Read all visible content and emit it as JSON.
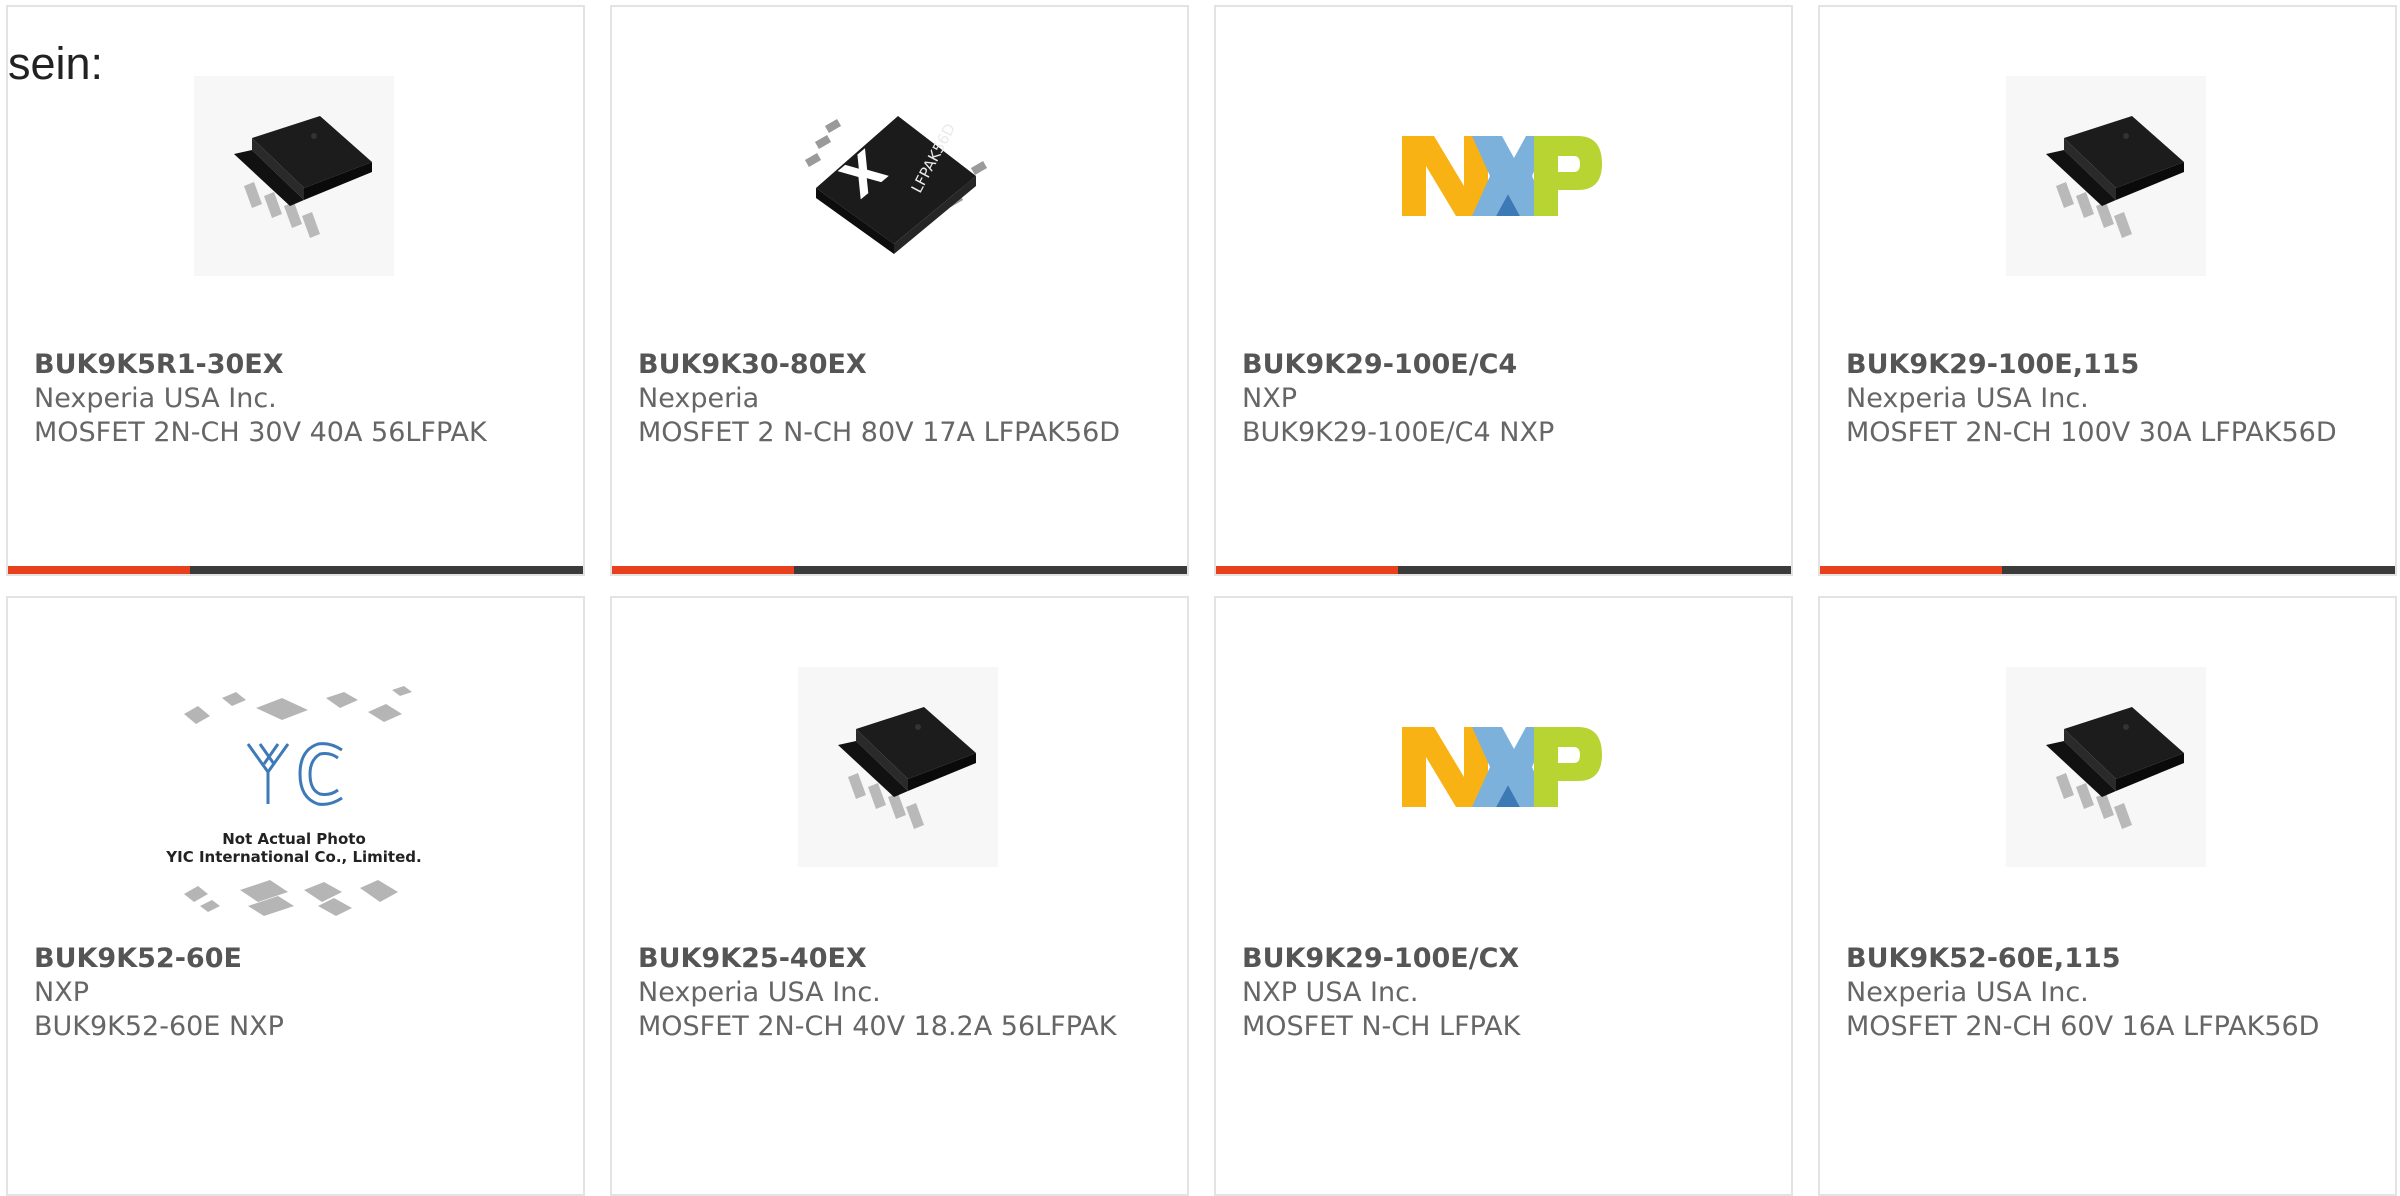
{
  "lead_text": "sein:",
  "products": [
    {
      "part": "BUK9K5R1-30EX",
      "manufacturer": "Nexperia USA Inc.",
      "description": "MOSFET 2N-CH 30V 40A 56LFPAK",
      "image": "lfpak-chip-photo"
    },
    {
      "part": "BUK9K30-80EX",
      "manufacturer": "Nexperia",
      "description": "MOSFET 2 N-CH 80V 17A LFPAK56D",
      "image": "lfpak56d-package",
      "image_text": "LFPAK56D"
    },
    {
      "part": "BUK9K29-100E/C4",
      "manufacturer": "NXP",
      "description": "BUK9K29-100E/C4 NXP",
      "image": "nxp-logo",
      "image_text": "NXP"
    },
    {
      "part": "BUK9K29-100E,115",
      "manufacturer": "Nexperia USA Inc.",
      "description": "MOSFET 2N-CH 100V 30A LFPAK56D",
      "image": "lfpak-chip-photo"
    },
    {
      "part": "BUK9K52-60E",
      "manufacturer": "NXP",
      "description": "BUK9K52-60E NXP",
      "image": "yic-placeholder",
      "image_caption": [
        "Not Actual Photo",
        "YIC International Co., Limited."
      ]
    },
    {
      "part": "BUK9K25-40EX",
      "manufacturer": "Nexperia USA Inc.",
      "description": "MOSFET 2N-CH 40V 18.2A 56LFPAK",
      "image": "lfpak-chip-photo"
    },
    {
      "part": "BUK9K29-100E/CX",
      "manufacturer": "NXP USA Inc.",
      "description": "MOSFET N-CH LFPAK",
      "image": "nxp-logo",
      "image_text": "NXP"
    },
    {
      "part": "BUK9K52-60E,115",
      "manufacturer": "Nexperia USA Inc.",
      "description": "MOSFET 2N-CH 60V 16A LFPAK56D",
      "image": "lfpak-chip-photo"
    }
  ],
  "colors": {
    "accent": "#e8401c",
    "bar": "#3b3b3b",
    "card_border": "#e3e3e3"
  }
}
